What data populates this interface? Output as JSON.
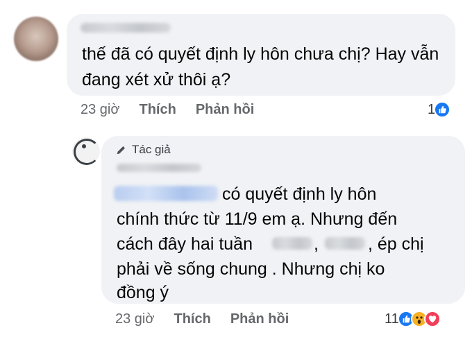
{
  "comment1": {
    "text": "thế đã có quyết định ly hôn chưa chị? Hay vẫn đang xét xử thôi ạ?",
    "time": "23 giờ",
    "like_label": "Thích",
    "reply_label": "Phản hồi",
    "reaction_count": "1",
    "reactions": [
      "like-icon"
    ]
  },
  "reply": {
    "badge": "Tác giả",
    "text_line1": "có quyết định ly hôn",
    "text_line2": "chính thức từ 11/9 em ạ. Nhưng đến",
    "text_line3a": "cách đây hai tuần",
    "text_line3b": ",",
    "text_line3c": ", ép chị",
    "text_line4": "phải về sống chung . Nhưng chị ko",
    "text_line5": "đồng ý",
    "time": "23 giờ",
    "like_label": "Thích",
    "reply_label": "Phản hồi",
    "reaction_count": "11",
    "reactions": [
      "like-icon",
      "wow-icon",
      "love-icon"
    ]
  },
  "colors": {
    "bubble": "#f0f2f5",
    "meta": "#65676b",
    "like": "#1877f2",
    "wow": "#f7b125",
    "love": "#f33e58"
  }
}
